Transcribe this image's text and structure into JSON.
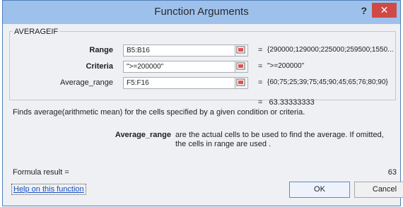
{
  "window": {
    "title": "Function Arguments",
    "help_glyph": "?",
    "close_glyph": "✕"
  },
  "function_name": "AVERAGEIF",
  "args": [
    {
      "label": "Range",
      "value": "B5:B16",
      "result": "{290000;129000;225000;259500;1550..."
    },
    {
      "label": "Criteria",
      "value": "\">=200000\"",
      "result": "\">=200000\""
    },
    {
      "label": "Average_range",
      "value": "F5:F16",
      "result": "{60;75;25;39;75;45;90;45;65;76;80;90}"
    }
  ],
  "equals": "=",
  "formula_preview": "63.33333333",
  "description": "Finds average(arithmetic mean) for the cells specified by a given condition or criteria.",
  "arg_help": {
    "name": "Average_range",
    "text": "are the actual cells to be used to find the average. If omitted, the cells in range are used ."
  },
  "footer": {
    "formula_result_label": "Formula result =",
    "formula_result_value": "63",
    "help_link": "Help on this function",
    "ok": "OK",
    "cancel": "Cancel"
  },
  "colors": {
    "titlebar": "#9ec1ec",
    "close": "#d04a45",
    "link": "#1a4fbf"
  }
}
